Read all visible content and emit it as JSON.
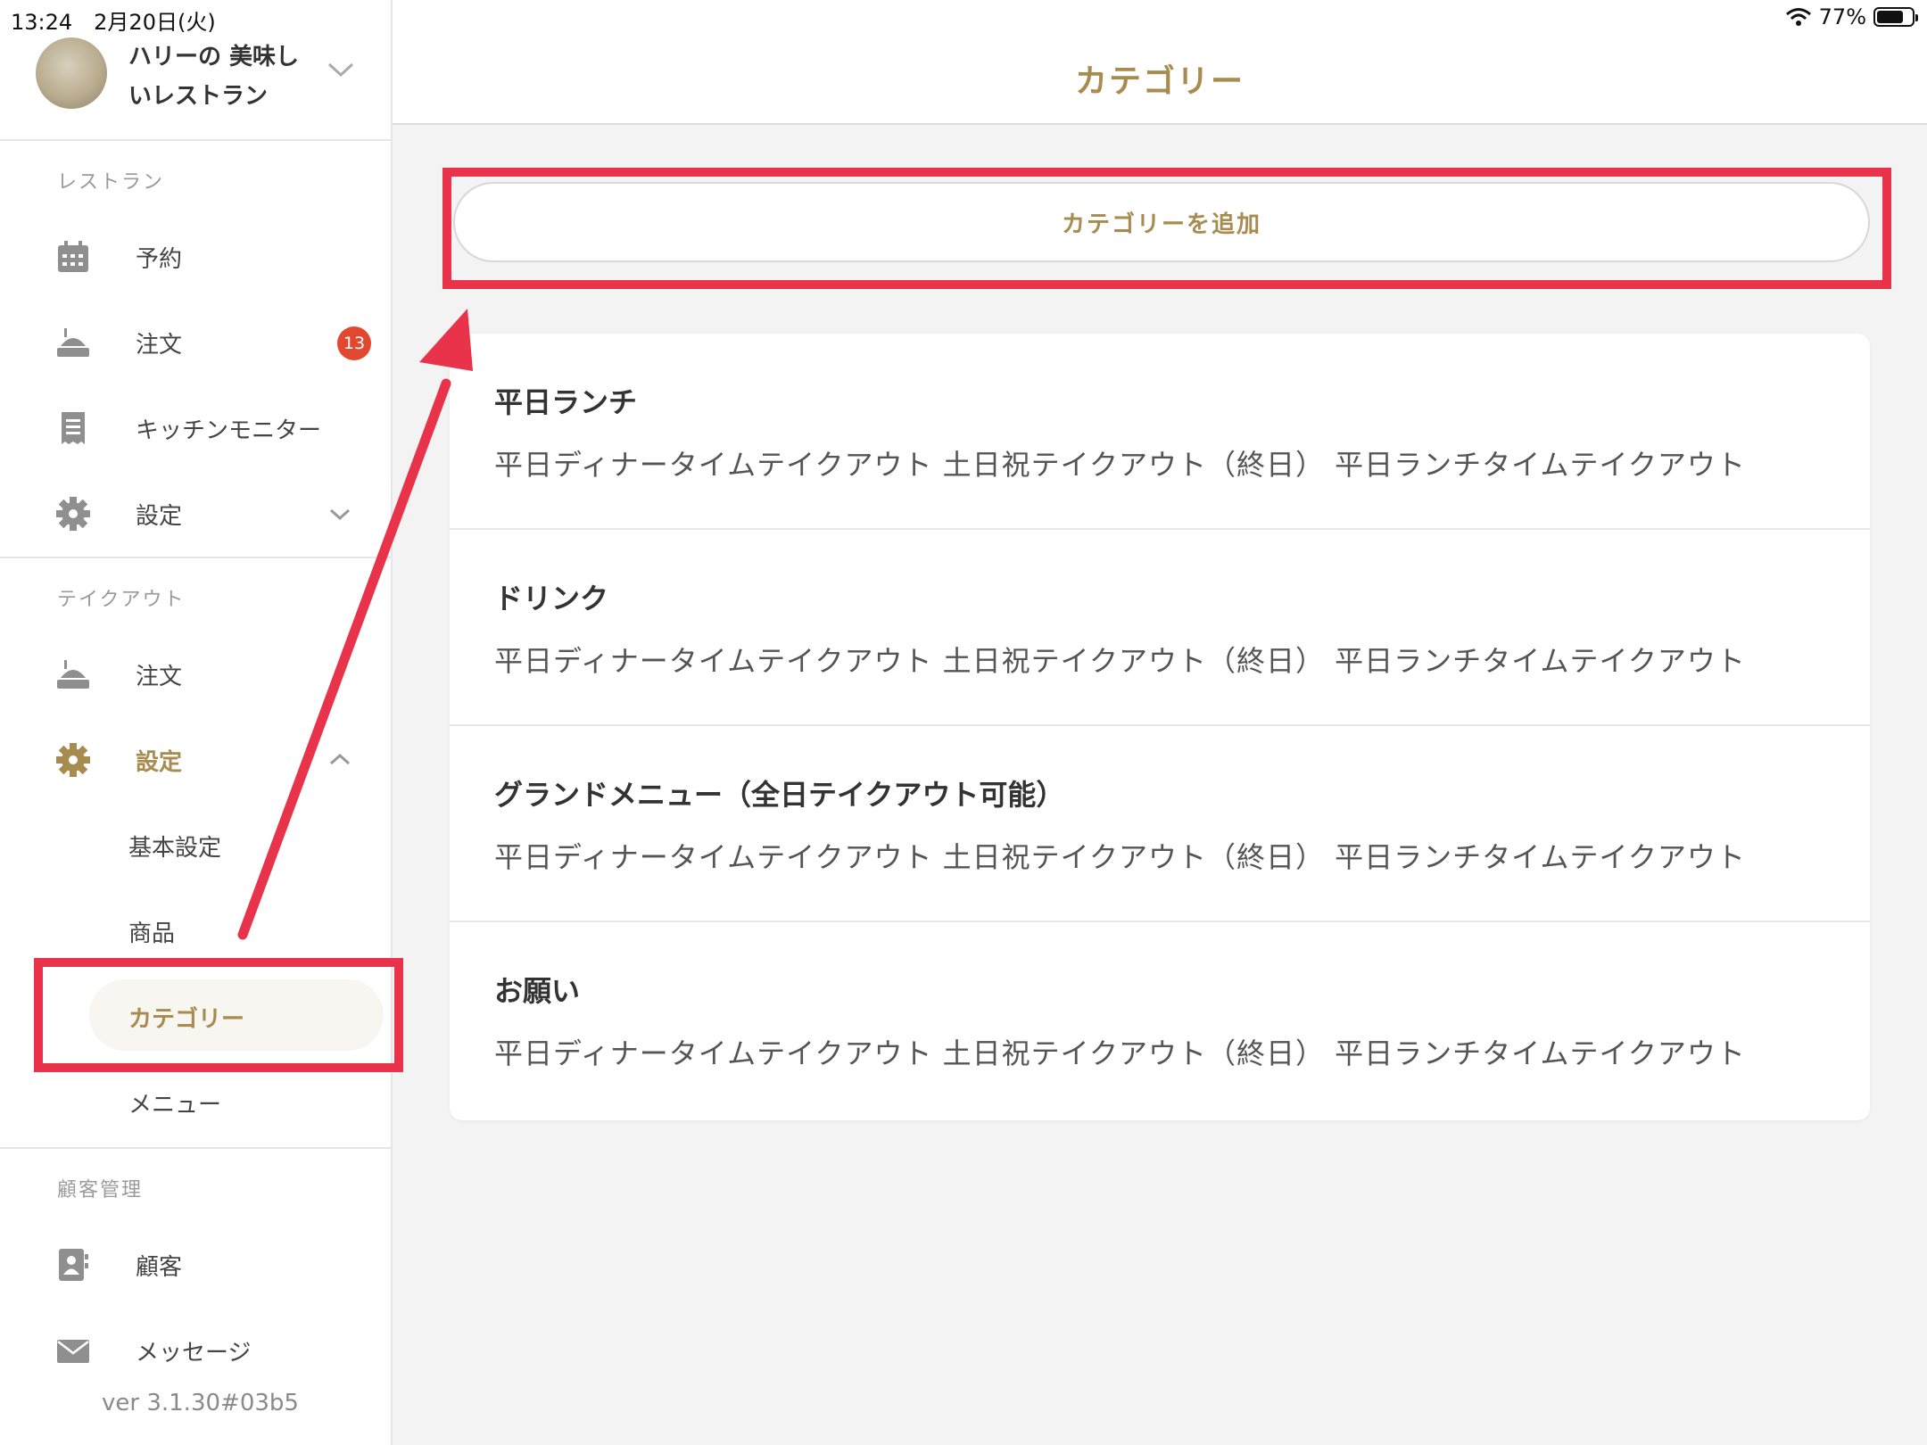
{
  "status_bar": {
    "time": "13:24　2月20日(火)",
    "battery": "77%",
    "battery_level": 0.77
  },
  "account": {
    "name": "ハリーの 美味しいレストラン"
  },
  "sections": {
    "restaurant": "レストラン",
    "takeout": "テイクアウト",
    "customer": "顧客管理"
  },
  "nav": {
    "reservation": "予約",
    "orders": "注文",
    "orders_badge": "13",
    "kitchen": "キッチンモニター",
    "settings": "設定",
    "takeout_orders": "注文",
    "takeout_settings": "設定",
    "basic_settings": "基本設定",
    "products": "商品",
    "categories": "カテゴリー",
    "menu": "メニュー",
    "customers": "顧客",
    "messages": "メッセージ"
  },
  "version": "ver 3.1.30#03b5",
  "main": {
    "title": "カテゴリー",
    "add_button": "カテゴリーを追加",
    "categories": [
      {
        "name": "平日ランチ",
        "tags": "平日ディナータイムテイクアウト 土日祝テイクアウト（終日） 平日ランチタイムテイクアウト"
      },
      {
        "name": "ドリンク",
        "tags": "平日ディナータイムテイクアウト 土日祝テイクアウト（終日） 平日ランチタイムテイクアウト"
      },
      {
        "name": "グランドメニュー（全日テイクアウト可能）",
        "tags": "平日ディナータイムテイクアウト 土日祝テイクアウト（終日） 平日ランチタイムテイクアウト"
      },
      {
        "name": "お願い",
        "tags": "平日ディナータイムテイクアウト 土日祝テイクアウト（終日） 平日ランチタイムテイクアウト"
      }
    ]
  },
  "colors": {
    "accent": "#a88b4f",
    "annotation": "#e8334a",
    "badge": "#e2472f"
  }
}
